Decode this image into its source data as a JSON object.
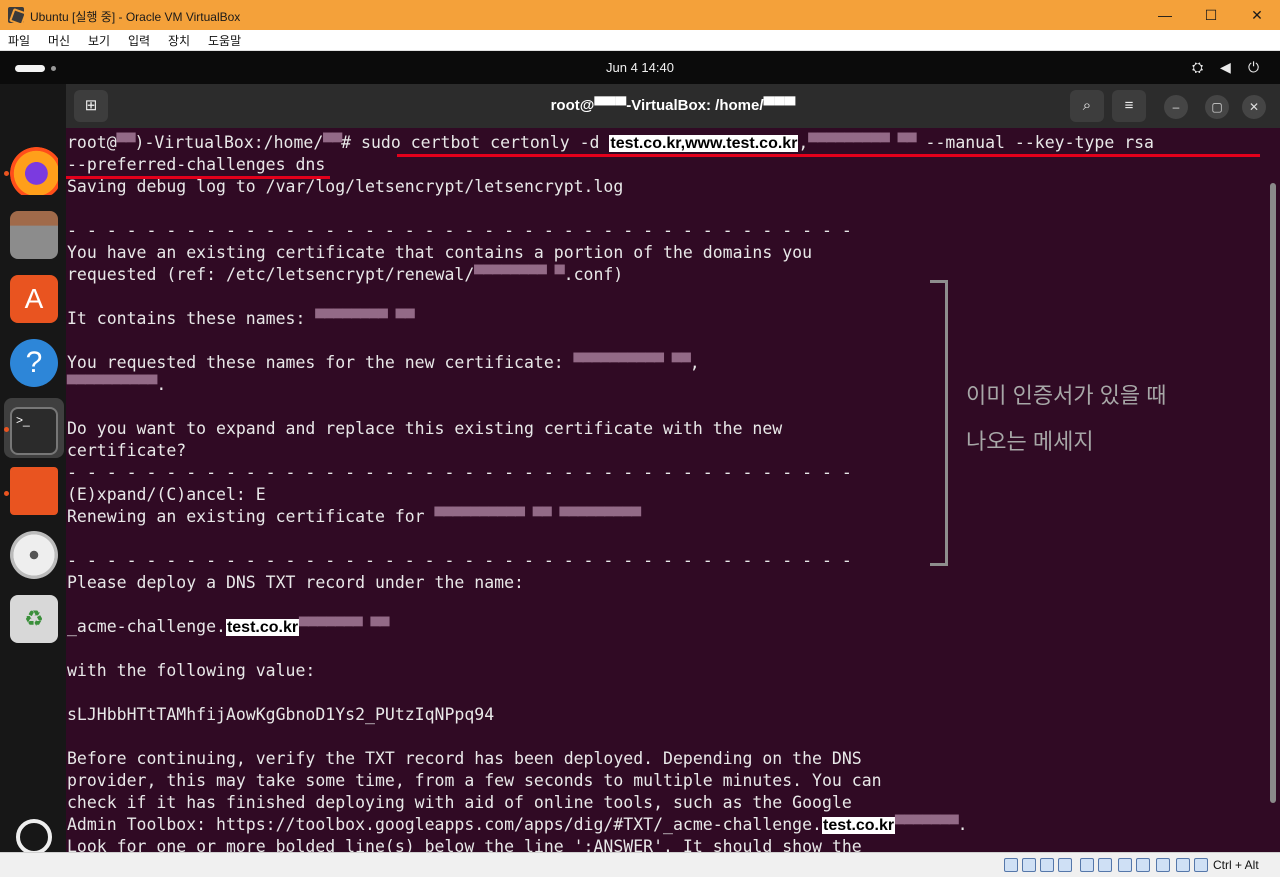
{
  "window": {
    "title": "Ubuntu [실행 중] - Oracle VM VirtualBox"
  },
  "menu": [
    "파일",
    "머신",
    "보기",
    "입력",
    "장치",
    "도움말"
  ],
  "topbar": {
    "clock": "Jun 4  14:40"
  },
  "terminal": {
    "title": "root@▀▀▀-VirtualBox: /home/▀▀▀"
  },
  "lines": [
    [
      {
        "t": "root@",
        "c": ""
      },
      {
        "t": "▀▀",
        "c": "blr"
      },
      {
        "t": ")-VirtualBox:/home/",
        "c": ""
      },
      {
        "t": "▀▀",
        "c": "blr"
      },
      {
        "t": "# sudo certbot certonly -d ",
        "c": ""
      },
      {
        "t": "test.co.kr,www.test.co.kr",
        "c": "lbl"
      },
      {
        "t": ",",
        "c": ""
      },
      {
        "t": "▀▀▀▀▀▀▀▀▀ ▀▀",
        "c": "blr"
      },
      {
        "t": " --manual --key-type rsa",
        "c": ""
      }
    ],
    [
      {
        "t": "--preferred-challenges dns",
        "c": ""
      }
    ],
    [
      {
        "t": "Saving debug log to /var/log/letsencrypt/letsencrypt.log",
        "c": ""
      }
    ],
    [
      {
        "t": "",
        "c": ""
      }
    ],
    [
      {
        "t": "- - - - - - - - - - - - - - - - - - - - - - - - - - - - - - - - - - - - - - - -",
        "c": ""
      }
    ],
    [
      {
        "t": "You have an existing certificate that contains a portion of the domains you",
        "c": ""
      }
    ],
    [
      {
        "t": "requested (ref: /etc/letsencrypt/renewal/",
        "c": ""
      },
      {
        "t": "▀▀▀▀▀▀▀▀ ▀",
        "c": "blr"
      },
      {
        "t": ".conf)",
        "c": ""
      }
    ],
    [
      {
        "t": "",
        "c": ""
      }
    ],
    [
      {
        "t": "It contains these names: ",
        "c": ""
      },
      {
        "t": "▀▀▀▀▀▀▀▀ ▀▀",
        "c": "blr"
      }
    ],
    [
      {
        "t": "",
        "c": ""
      }
    ],
    [
      {
        "t": "You requested these names for the new certificate: ",
        "c": ""
      },
      {
        "t": "▀▀▀▀▀▀▀▀▀▀ ▀▀",
        "c": "blr"
      },
      {
        "t": ",",
        "c": ""
      }
    ],
    [
      {
        "t": "▀▀▀▀▀▀▀▀▀▀",
        "c": "blr"
      },
      {
        "t": ".",
        "c": ""
      }
    ],
    [
      {
        "t": "",
        "c": ""
      }
    ],
    [
      {
        "t": "Do you want to expand and replace this existing certificate with the new",
        "c": ""
      }
    ],
    [
      {
        "t": "certificate?",
        "c": ""
      }
    ],
    [
      {
        "t": "- - - - - - - - - - - - - - - - - - - - - - - - - - - - - - - - - - - - - - - -",
        "c": ""
      }
    ],
    [
      {
        "t": "(E)xpand/(C)ancel: E",
        "c": ""
      }
    ],
    [
      {
        "t": "Renewing an existing certificate for ",
        "c": ""
      },
      {
        "t": "▀▀▀▀▀▀▀▀▀▀ ▀▀ ▀▀▀▀▀▀▀▀▀",
        "c": "blr"
      }
    ],
    [
      {
        "t": "",
        "c": ""
      }
    ],
    [
      {
        "t": "- - - - - - - - - - - - - - - - - - - - - - - - - - - - - - - - - - - - - - - -",
        "c": ""
      }
    ],
    [
      {
        "t": "Please deploy a DNS TXT record under the name:",
        "c": ""
      }
    ],
    [
      {
        "t": "",
        "c": ""
      }
    ],
    [
      {
        "t": "_acme-challenge.",
        "c": ""
      },
      {
        "t": "test.co.kr",
        "c": "lbl"
      },
      {
        "t": "▀▀▀▀▀▀▀ ▀▀",
        "c": "blr"
      }
    ],
    [
      {
        "t": "",
        "c": ""
      }
    ],
    [
      {
        "t": "with the following value:",
        "c": ""
      }
    ],
    [
      {
        "t": "",
        "c": ""
      }
    ],
    [
      {
        "t": "sLJHbbHTtTAMhfijAowKgGbnoD1Ys2_PUtzIqNPpq94",
        "c": ""
      }
    ],
    [
      {
        "t": "",
        "c": ""
      }
    ],
    [
      {
        "t": "Before continuing, verify the TXT record has been deployed. Depending on the DNS",
        "c": ""
      }
    ],
    [
      {
        "t": "provider, this may take some time, from a few seconds to multiple minutes. You can",
        "c": ""
      }
    ],
    [
      {
        "t": "check if it has finished deploying with aid of online tools, such as the Google",
        "c": ""
      }
    ],
    [
      {
        "t": "Admin Toolbox: https://toolbox.googleapps.com/apps/dig/#TXT/_acme-challenge.",
        "c": ""
      },
      {
        "t": "test.co.kr",
        "c": "lbl"
      },
      {
        "t": "▀▀▀▀▀▀▀",
        "c": "blr"
      },
      {
        "t": ".",
        "c": ""
      }
    ],
    [
      {
        "t": "Look for one or more bolded line(s) below the line ';ANSWER'. It should show the",
        "c": ""
      }
    ]
  ],
  "note": {
    "line1": "이미 인증서가 있을 때",
    "line2": "나오는 메세지"
  },
  "statusbar": {
    "host_key": "Ctrl + Alt"
  }
}
